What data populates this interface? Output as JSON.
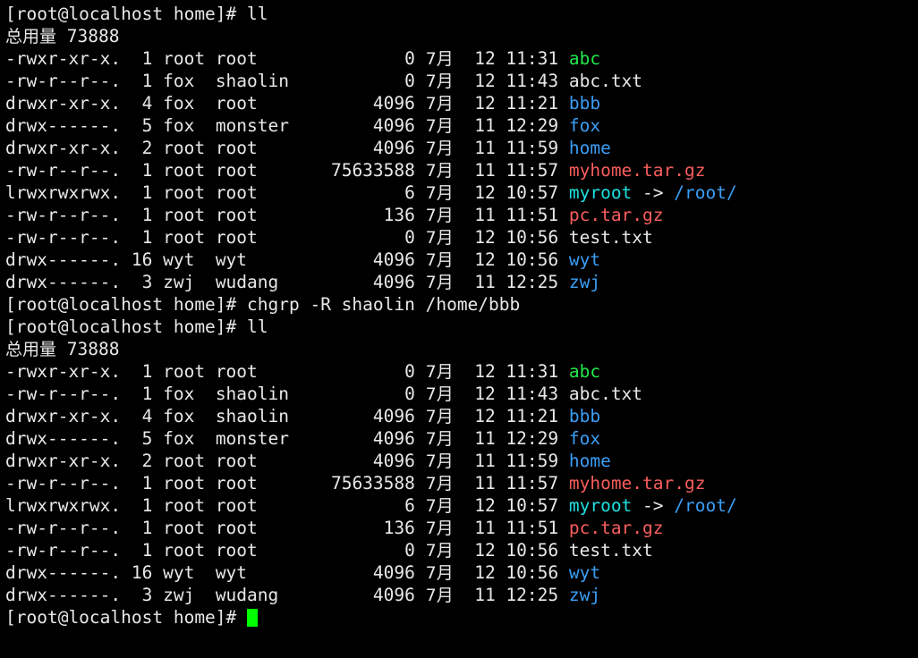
{
  "terminal": {
    "prompt": "[root@localhost home]#",
    "background": "#000000",
    "foreground": "#e8e8e8",
    "colors": {
      "directory": "#3b9ef5",
      "executable": "#22e84a",
      "archive": "#f95d5d",
      "symlink": "#1fe0e0",
      "cursor": "#00ff00"
    },
    "cursor_visible": true
  },
  "lines": [
    {
      "type": "prompt",
      "prompt": "[root@localhost home]#",
      "command": " ll"
    },
    {
      "type": "total",
      "text": "总用量 73888"
    },
    {
      "type": "file",
      "perms": "-rwxr-xr-x.",
      "links": " 1",
      "user": "root",
      "group": "root",
      "size": "0",
      "month": "7月",
      "day": "12",
      "time": "11:31",
      "name": "abc",
      "color": "exe"
    },
    {
      "type": "file",
      "perms": "-rw-r--r--.",
      "links": " 1",
      "user": "fox",
      "group": "shaolin",
      "size": "0",
      "month": "7月",
      "day": "12",
      "time": "11:43",
      "name": "abc.txt",
      "color": "w"
    },
    {
      "type": "file",
      "perms": "drwxr-xr-x.",
      "links": " 4",
      "user": "fox",
      "group": "root",
      "size": "4096",
      "month": "7月",
      "day": "12",
      "time": "11:21",
      "name": "bbb",
      "color": "dir"
    },
    {
      "type": "file",
      "perms": "drwx------.",
      "links": " 5",
      "user": "fox",
      "group": "monster",
      "size": "4096",
      "month": "7月",
      "day": "11",
      "time": "12:29",
      "name": "fox",
      "color": "dir"
    },
    {
      "type": "file",
      "perms": "drwxr-xr-x.",
      "links": " 2",
      "user": "root",
      "group": "root",
      "size": "4096",
      "month": "7月",
      "day": "11",
      "time": "11:59",
      "name": "home",
      "color": "dir"
    },
    {
      "type": "file",
      "perms": "-rw-r--r--.",
      "links": " 1",
      "user": "root",
      "group": "root",
      "size": "75633588",
      "month": "7月",
      "day": "11",
      "time": "11:57",
      "name": "myhome.tar.gz",
      "color": "arc"
    },
    {
      "type": "link",
      "perms": "lrwxrwxrwx.",
      "links": " 1",
      "user": "root",
      "group": "root",
      "size": "6",
      "month": "7月",
      "day": "12",
      "time": "10:57",
      "name": "myroot",
      "color": "lnk",
      "arrow": " -> ",
      "target": "/root/",
      "target_color": "dir"
    },
    {
      "type": "file",
      "perms": "-rw-r--r--.",
      "links": " 1",
      "user": "root",
      "group": "root",
      "size": "136",
      "month": "7月",
      "day": "11",
      "time": "11:51",
      "name": "pc.tar.gz",
      "color": "arc"
    },
    {
      "type": "file",
      "perms": "-rw-r--r--.",
      "links": " 1",
      "user": "root",
      "group": "root",
      "size": "0",
      "month": "7月",
      "day": "12",
      "time": "10:56",
      "name": "test.txt",
      "color": "w"
    },
    {
      "type": "file",
      "perms": "drwx------.",
      "links": "16",
      "user": "wyt",
      "group": "wyt",
      "size": "4096",
      "month": "7月",
      "day": "12",
      "time": "10:56",
      "name": "wyt",
      "color": "dir"
    },
    {
      "type": "file",
      "perms": "drwx------.",
      "links": " 3",
      "user": "zwj",
      "group": "wudang",
      "size": "4096",
      "month": "7月",
      "day": "11",
      "time": "12:25",
      "name": "zwj",
      "color": "dir"
    },
    {
      "type": "prompt",
      "prompt": "[root@localhost home]#",
      "command": " chgrp -R shaolin /home/bbb"
    },
    {
      "type": "prompt",
      "prompt": "[root@localhost home]#",
      "command": " ll"
    },
    {
      "type": "total",
      "text": "总用量 73888"
    },
    {
      "type": "file",
      "perms": "-rwxr-xr-x.",
      "links": " 1",
      "user": "root",
      "group": "root",
      "size": "0",
      "month": "7月",
      "day": "12",
      "time": "11:31",
      "name": "abc",
      "color": "exe"
    },
    {
      "type": "file",
      "perms": "-rw-r--r--.",
      "links": " 1",
      "user": "fox",
      "group": "shaolin",
      "size": "0",
      "month": "7月",
      "day": "12",
      "time": "11:43",
      "name": "abc.txt",
      "color": "w"
    },
    {
      "type": "file",
      "perms": "drwxr-xr-x.",
      "links": " 4",
      "user": "fox",
      "group": "shaolin",
      "size": "4096",
      "month": "7月",
      "day": "12",
      "time": "11:21",
      "name": "bbb",
      "color": "dir"
    },
    {
      "type": "file",
      "perms": "drwx------.",
      "links": " 5",
      "user": "fox",
      "group": "monster",
      "size": "4096",
      "month": "7月",
      "day": "11",
      "time": "12:29",
      "name": "fox",
      "color": "dir"
    },
    {
      "type": "file",
      "perms": "drwxr-xr-x.",
      "links": " 2",
      "user": "root",
      "group": "root",
      "size": "4096",
      "month": "7月",
      "day": "11",
      "time": "11:59",
      "name": "home",
      "color": "dir"
    },
    {
      "type": "file",
      "perms": "-rw-r--r--.",
      "links": " 1",
      "user": "root",
      "group": "root",
      "size": "75633588",
      "month": "7月",
      "day": "11",
      "time": "11:57",
      "name": "myhome.tar.gz",
      "color": "arc"
    },
    {
      "type": "link",
      "perms": "lrwxrwxrwx.",
      "links": " 1",
      "user": "root",
      "group": "root",
      "size": "6",
      "month": "7月",
      "day": "12",
      "time": "10:57",
      "name": "myroot",
      "color": "lnk",
      "arrow": " -> ",
      "target": "/root/",
      "target_color": "dir"
    },
    {
      "type": "file",
      "perms": "-rw-r--r--.",
      "links": " 1",
      "user": "root",
      "group": "root",
      "size": "136",
      "month": "7月",
      "day": "11",
      "time": "11:51",
      "name": "pc.tar.gz",
      "color": "arc"
    },
    {
      "type": "file",
      "perms": "-rw-r--r--.",
      "links": " 1",
      "user": "root",
      "group": "root",
      "size": "0",
      "month": "7月",
      "day": "12",
      "time": "10:56",
      "name": "test.txt",
      "color": "w"
    },
    {
      "type": "file",
      "perms": "drwx------.",
      "links": "16",
      "user": "wyt",
      "group": "wyt",
      "size": "4096",
      "month": "7月",
      "day": "12",
      "time": "10:56",
      "name": "wyt",
      "color": "dir"
    },
    {
      "type": "file",
      "perms": "drwx------.",
      "links": " 3",
      "user": "zwj",
      "group": "wudang",
      "size": "4096",
      "month": "7月",
      "day": "11",
      "time": "12:25",
      "name": "zwj",
      "color": "dir"
    },
    {
      "type": "cursor-prompt",
      "prompt": "[root@localhost home]#",
      "command": " "
    }
  ]
}
